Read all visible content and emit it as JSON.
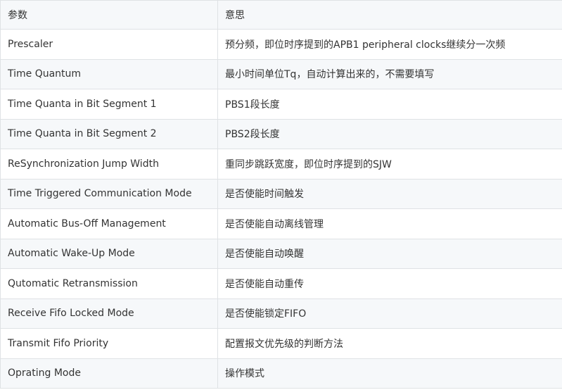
{
  "table": {
    "headers": [
      "参数",
      "意思"
    ],
    "rows": [
      [
        "Prescaler",
        "预分频，即位时序提到的APB1 peripheral clocks继续分一次频"
      ],
      [
        "Time Quantum",
        "最小时间单位Tq，自动计算出来的，不需要填写"
      ],
      [
        "Time Quanta in Bit Segment 1",
        "PBS1段长度"
      ],
      [
        "Time Quanta in Bit Segment 2",
        "PBS2段长度"
      ],
      [
        "ReSynchronization Jump Width",
        "重同步跳跃宽度，即位时序提到的SJW"
      ],
      [
        "Time Triggered Communication Mode",
        "是否使能时间触发"
      ],
      [
        "Automatic Bus-Off Management",
        "是否使能自动离线管理"
      ],
      [
        "Automatic Wake-Up Mode",
        "是否使能自动唤醒"
      ],
      [
        "Qutomatic Retransmission",
        "是否使能自动重传"
      ],
      [
        "Receive Fifo Locked Mode",
        "是否使能锁定FIFO"
      ],
      [
        "Transmit Fifo Priority",
        "配置报文优先级的判断方法"
      ],
      [
        "Oprating Mode",
        "操作模式"
      ]
    ]
  }
}
